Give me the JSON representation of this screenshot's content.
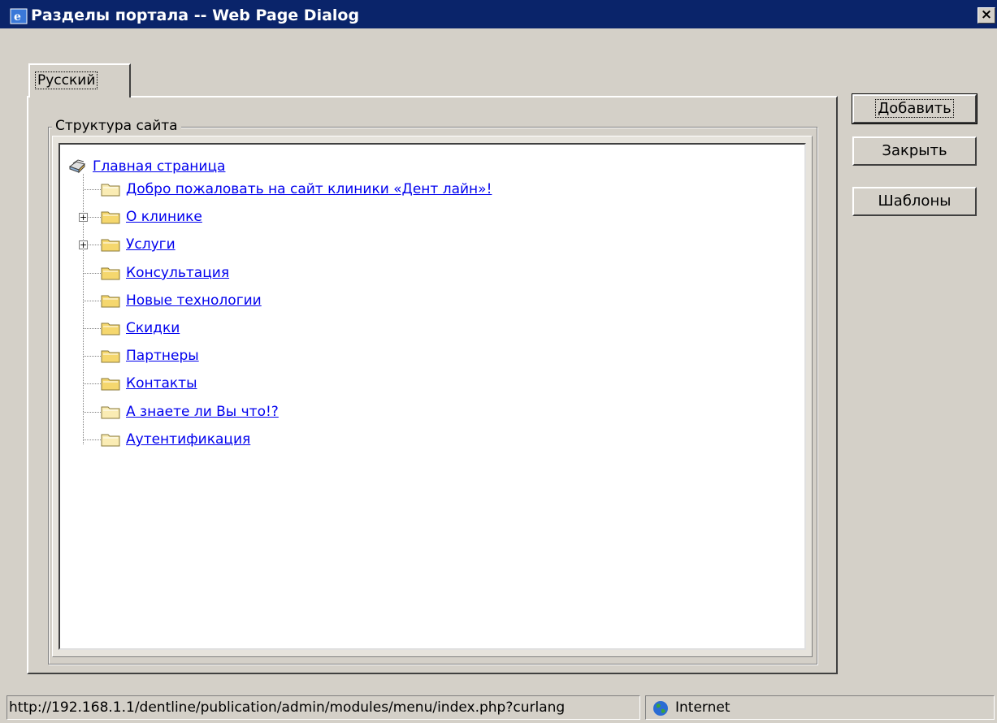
{
  "window": {
    "title": "Разделы портала -- Web Page Dialog",
    "close_label": "×",
    "icon": "ie-icon"
  },
  "tab": {
    "label": "Русский"
  },
  "fieldset": {
    "legend": "Структура сайта"
  },
  "tree": {
    "root": {
      "label": "Главная страница",
      "icon": "books-icon"
    },
    "items": [
      {
        "label": "Добро пожаловать на сайт клиники «Дент лайн»!",
        "expandable": false,
        "faded": true
      },
      {
        "label": "О клинике",
        "expandable": true,
        "faded": false
      },
      {
        "label": "Услуги",
        "expandable": true,
        "faded": false
      },
      {
        "label": "Консультация",
        "expandable": false,
        "faded": false
      },
      {
        "label": "Новые технологии",
        "expandable": false,
        "faded": false
      },
      {
        "label": "Скидки",
        "expandable": false,
        "faded": false
      },
      {
        "label": "Партнеры",
        "expandable": false,
        "faded": false
      },
      {
        "label": "Контакты",
        "expandable": false,
        "faded": false
      },
      {
        "label": "А знаете ли Вы что!?",
        "expandable": false,
        "faded": true
      },
      {
        "label": "Аутентификация",
        "expandable": false,
        "faded": true
      }
    ]
  },
  "buttons": {
    "add": "Добавить",
    "close": "Закрыть",
    "templates": "Шаблоны"
  },
  "statusbar": {
    "url": "http://192.168.1.1/dentline/publication/admin/modules/menu/index.php?curlang",
    "zone": "Internet"
  },
  "colors": {
    "titlebar": "#0a246a",
    "face": "#d4d0c8",
    "link": "#0000ee",
    "folder": "#f5d76e",
    "folder_faded": "#faecb4"
  }
}
